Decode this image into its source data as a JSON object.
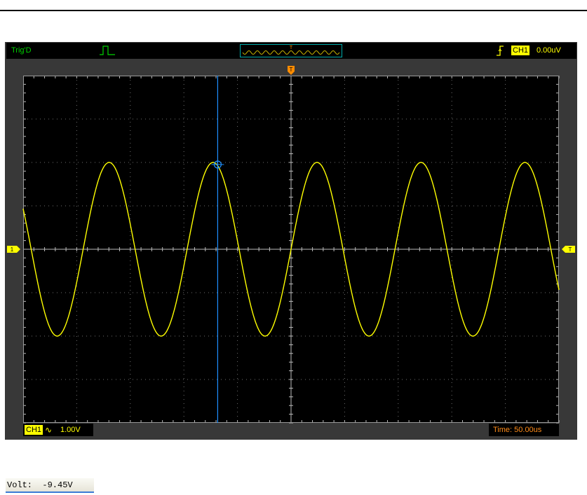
{
  "header": {
    "trigger_status": "Trig'D",
    "trigger_channel": "CH1",
    "trigger_level": "0.00uV",
    "icons": [
      "pulse-icon",
      "waveform-overview",
      "rising-edge-icon"
    ]
  },
  "screen": {
    "markers": {
      "channel_marker": "1",
      "trigger_position_marker": "T",
      "trigger_level_marker": "T"
    },
    "divisions": {
      "horizontal": 10,
      "vertical": 8
    },
    "waveform": {
      "channel": "CH1",
      "shape": "sine",
      "amplitude_divisions": 2.0,
      "periods_visible": 5
    },
    "cursor": {
      "type": "vertical",
      "horizontal_division": 3.5
    }
  },
  "footer": {
    "channel": "CH1",
    "coupling_icon": "ac-coupling-icon",
    "volts_per_div": "1.00V",
    "timebase": "Time: 50.00us"
  },
  "readout": {
    "volt": "Volt:  -9.45V"
  },
  "colors": {
    "trace": "#ffff00",
    "cursor": "#1e90ff",
    "status": "#00d200",
    "timebase": "#ff8c1a",
    "trigger_marker": "#ff8c00"
  }
}
